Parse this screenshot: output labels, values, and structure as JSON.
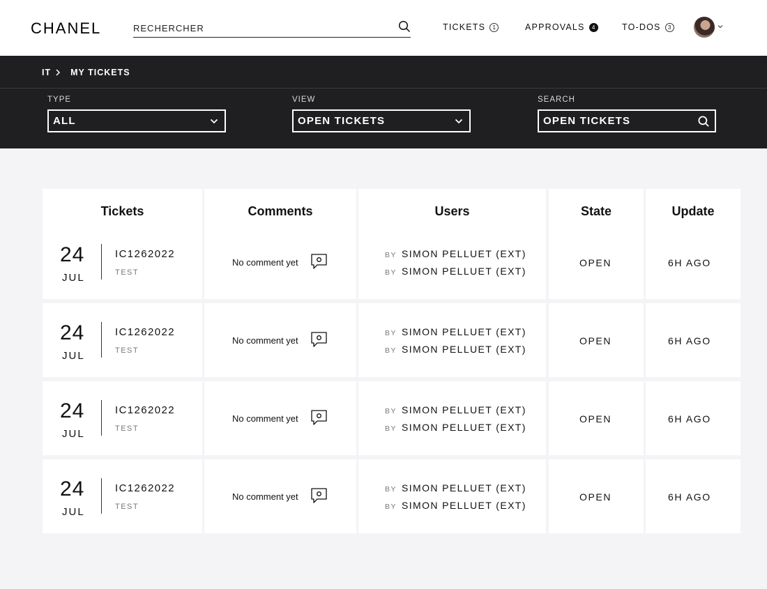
{
  "header": {
    "logo": "CHANEL",
    "search_placeholder": "RECHERCHER",
    "nav": [
      {
        "label": "TICKETS",
        "badge": "1",
        "filled": false
      },
      {
        "label": "APPROVALS",
        "badge": "4",
        "filled": true
      },
      {
        "label": "TO-DOS",
        "badge": "3",
        "filled": false
      }
    ]
  },
  "breadcrumb": [
    "IT",
    "MY TICKETS"
  ],
  "filters": {
    "type": {
      "label": "TYPE",
      "value": "ALL"
    },
    "view": {
      "label": "VIEW",
      "value": "OPEN TICKETS"
    },
    "search": {
      "label": "SEARCH",
      "value": "OPEN TICKETS"
    }
  },
  "table": {
    "columns": [
      "Tickets",
      "Comments",
      "Users",
      "State",
      "Update"
    ],
    "rows": [
      {
        "day": "24",
        "month": "JUL",
        "id": "IC1262022",
        "subtitle": "TEST",
        "comment": "No comment yet",
        "by_label": "BY",
        "users": [
          "SIMON PELLUET (EXT)",
          "SIMON PELLUET (EXT)"
        ],
        "state": "OPEN",
        "update": "6H AGO"
      },
      {
        "day": "24",
        "month": "JUL",
        "id": "IC1262022",
        "subtitle": "TEST",
        "comment": "No comment yet",
        "by_label": "BY",
        "users": [
          "SIMON PELLUET (EXT)",
          "SIMON PELLUET (EXT)"
        ],
        "state": "OPEN",
        "update": "6H AGO"
      },
      {
        "day": "24",
        "month": "JUL",
        "id": "IC1262022",
        "subtitle": "TEST",
        "comment": "No comment yet",
        "by_label": "BY",
        "users": [
          "SIMON PELLUET (EXT)",
          "SIMON PELLUET (EXT)"
        ],
        "state": "OPEN",
        "update": "6H AGO"
      },
      {
        "day": "24",
        "month": "JUL",
        "id": "IC1262022",
        "subtitle": "TEST",
        "comment": "No comment yet",
        "by_label": "BY",
        "users": [
          "SIMON PELLUET (EXT)",
          "SIMON PELLUET (EXT)"
        ],
        "state": "OPEN",
        "update": "6H AGO"
      }
    ]
  },
  "icons": {
    "search": "search-icon",
    "chevron": "chevron-down-icon",
    "comment": "comment-bubble-icon",
    "avatar": "avatar"
  }
}
